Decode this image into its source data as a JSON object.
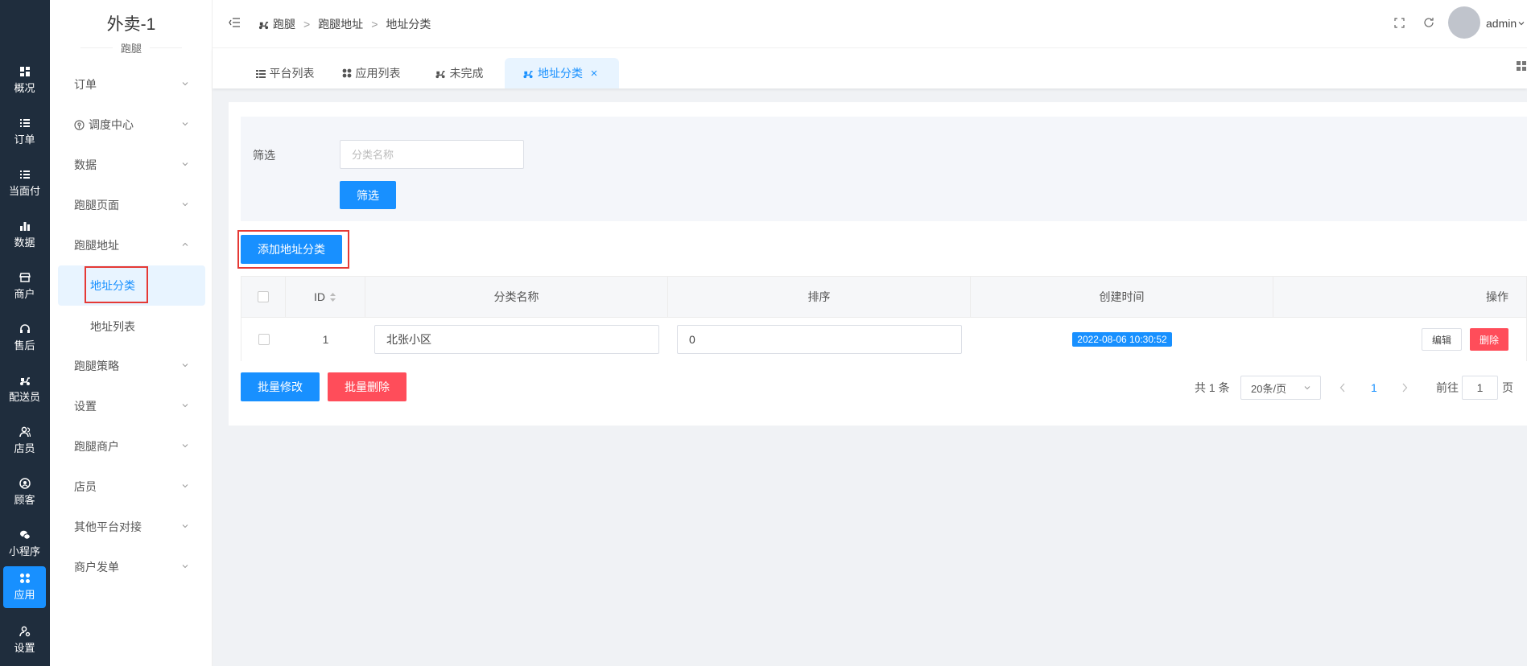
{
  "rail": {
    "items": [
      {
        "label": "概况",
        "icon": "dashboard-icon"
      },
      {
        "label": "订单",
        "icon": "list-icon"
      },
      {
        "label": "当面付",
        "icon": "list-icon"
      },
      {
        "label": "数据",
        "icon": "bar-chart-icon"
      },
      {
        "label": "商户",
        "icon": "shop-icon"
      },
      {
        "label": "售后",
        "icon": "headset-icon"
      },
      {
        "label": "配送员",
        "icon": "scooter-icon"
      },
      {
        "label": "店员",
        "icon": "users-icon"
      },
      {
        "label": "顾客",
        "icon": "user-circle-icon"
      },
      {
        "label": "小程序",
        "icon": "wechat-icon"
      },
      {
        "label": "应用",
        "icon": "apps-icon"
      },
      {
        "label": "设置",
        "icon": "user-gear-icon"
      }
    ],
    "active_index": 10
  },
  "subnav": {
    "title": "外卖-1",
    "subtitle": "跑腿",
    "menu": [
      {
        "label": "订单"
      },
      {
        "label": "调度中心"
      },
      {
        "label": "数据"
      },
      {
        "label": "跑腿页面"
      },
      {
        "label": "跑腿地址"
      },
      {
        "label": "地址分类"
      },
      {
        "label": "地址列表"
      },
      {
        "label": "跑腿策略"
      },
      {
        "label": "设置"
      },
      {
        "label": "跑腿商户"
      },
      {
        "label": "店员"
      },
      {
        "label": "其他平台对接"
      },
      {
        "label": "商户发单"
      }
    ]
  },
  "header": {
    "breadcrumb": [
      "跑腿",
      "跑腿地址",
      "地址分类"
    ],
    "user": "admin"
  },
  "tabs": [
    {
      "label": "平台列表"
    },
    {
      "label": "应用列表"
    },
    {
      "label": "未完成"
    },
    {
      "label": "地址分类"
    }
  ],
  "filter": {
    "label": "筛选",
    "placeholder": "分类名称",
    "button": "筛选"
  },
  "add_button": "添加地址分类",
  "table": {
    "headers": [
      "ID",
      "分类名称",
      "排序",
      "创建时间",
      "操作"
    ],
    "rows": [
      {
        "id": "1",
        "name": "北张小区",
        "sort": "0",
        "created": "2022-08-06 10:30:52",
        "edit": "编辑",
        "delete": "删除"
      }
    ]
  },
  "bulk": {
    "edit": "批量修改",
    "delete": "批量删除"
  },
  "pagination": {
    "total": "共 1 条",
    "page_size": "20条/页",
    "current": "1",
    "goto_label": "前往",
    "goto_value": "1",
    "page_suffix": "页"
  },
  "colors": {
    "primary": "#1890ff",
    "danger": "#ff4d5a",
    "rail": "#1f2d3d"
  }
}
